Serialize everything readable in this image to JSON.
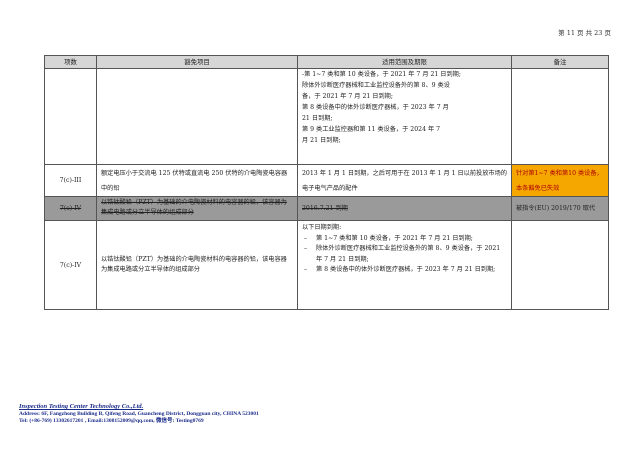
{
  "page_number": "第 11 页 共 23 页",
  "table": {
    "headers": [
      "项数",
      "豁免项目",
      "适用范围及期限",
      "备注"
    ],
    "row_a": {
      "scope_lines": [
        "-第 1~7 类和第 10 类设备，于 2021 年 7 月 21 日到期;",
        "除体外诊断医疗器械和工业监控设备外的第 8、9 类设",
        "备，于 2021 年 7 月 21 日到期;",
        "第 8 类设备中的体外诊断医疗器械，于 2023 年 7 月",
        "21 日到期;",
        "第 9 类工业监控器和第 11 类设备，于 2024 年 7",
        "月 21 日到期;"
      ]
    },
    "row_b": {
      "item": "7(c)-III",
      "exemption": "额定电压小于交流电 125 伏特或直流电 250 伏特的介电陶瓷电容器中的铅",
      "scope": "2013 年 1 月 1 日到期，之后可用于在 2013 年 1 月 1 日以前投放市场的电子电气产品的配件",
      "note": "针对第1~7 类和第10 类设备，本条豁免已失效"
    },
    "row_c": {
      "item": "7(c)-IV",
      "exemption": "以锆钛酸铅（PZT）为基础的介电陶瓷材料的电容器的铅，该容器为集成电路或分立半导体的组成部分",
      "scope": "2016.7.21 到期",
      "note": "被指令(EU) 2019/170 取代"
    },
    "row_d": {
      "item": "7(c)-IV",
      "exemption": "以锆钛酸铅（PZT）为基础的介电陶瓷材料的电容器的铅，该电容器为集成电路或分立半导体的组成部分",
      "scope_intro": "以下日期到期:",
      "scope_items": [
        "第 1~7 类和第 10 类设备，于 2021 年 7 月 21 日到期;",
        "除体外诊断医疗器械和工业监控设备外的第 8、9 类设备，于 2021 年 7 月 21 日到期;",
        "第 8 类设备中的体外诊断医疗器械，于 2023 年 7 月 21 日到期;"
      ]
    }
  },
  "footer": {
    "company": "Inspection Testing Center Technology Co.,Ltd.",
    "address": "Address: 6F, Fangzhong Building B, Qifeng Road, Guancheng District, Dongguan city, CHINA 523001",
    "contact": "Tel: (+86-769) 13302617201 , Email:1308152009@qq.com, 微信号: Testing0769"
  }
}
